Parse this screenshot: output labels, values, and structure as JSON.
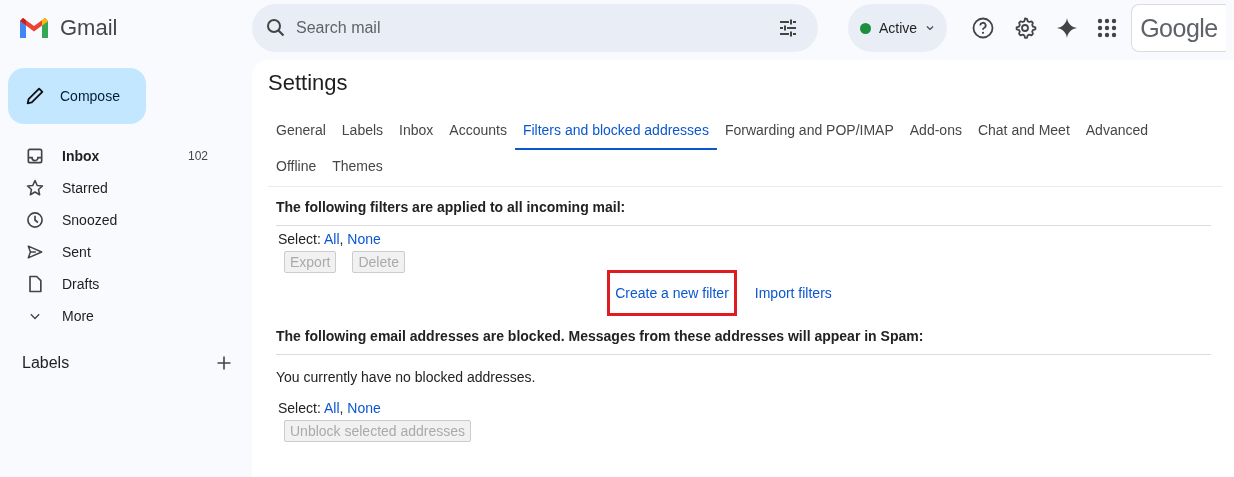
{
  "app": {
    "name": "Gmail"
  },
  "search": {
    "placeholder": "Search mail"
  },
  "status": {
    "label": "Active",
    "color": "#1e8e3e"
  },
  "account": {
    "logo_text": "Google"
  },
  "compose": {
    "label": "Compose"
  },
  "sidebar": {
    "items": [
      {
        "label": "Inbox",
        "count": "102",
        "selected": true
      },
      {
        "label": "Starred",
        "selected": false
      },
      {
        "label": "Snoozed",
        "selected": false
      },
      {
        "label": "Sent",
        "selected": false
      },
      {
        "label": "Drafts",
        "selected": false
      },
      {
        "label": "More",
        "selected": false
      }
    ],
    "labels_heading": "Labels"
  },
  "settings": {
    "title": "Settings",
    "tab_rows": [
      [
        {
          "label": "General",
          "selected": false
        },
        {
          "label": "Labels",
          "selected": false
        },
        {
          "label": "Inbox",
          "selected": false
        },
        {
          "label": "Accounts",
          "selected": false
        },
        {
          "label": "Filters and blocked addresses",
          "selected": true
        },
        {
          "label": "Forwarding and POP/IMAP",
          "selected": false
        },
        {
          "label": "Add-ons",
          "selected": false
        },
        {
          "label": "Chat and Meet",
          "selected": false
        },
        {
          "label": "Advanced",
          "selected": false
        }
      ],
      [
        {
          "label": "Offline",
          "selected": false
        },
        {
          "label": "Themes",
          "selected": false
        }
      ]
    ],
    "filters": {
      "heading": "The following filters are applied to all incoming mail:",
      "select_label": "Select:",
      "select_all": "All",
      "separator": ",",
      "select_none": "None",
      "buttons": [
        {
          "label": "Export",
          "disabled": true
        },
        {
          "label": "Delete",
          "disabled": true
        }
      ],
      "links": [
        {
          "label": "Create a new filter",
          "highlighted": true
        },
        {
          "label": "Import filters",
          "highlighted": false
        }
      ]
    },
    "blocked": {
      "heading": "The following email addresses are blocked. Messages from these addresses will appear in Spam:",
      "empty_message": "You currently have no blocked addresses.",
      "select_label": "Select:",
      "select_all": "All",
      "separator": ",",
      "select_none": "None",
      "buttons": [
        {
          "label": "Unblock selected addresses",
          "disabled": true
        }
      ]
    }
  }
}
